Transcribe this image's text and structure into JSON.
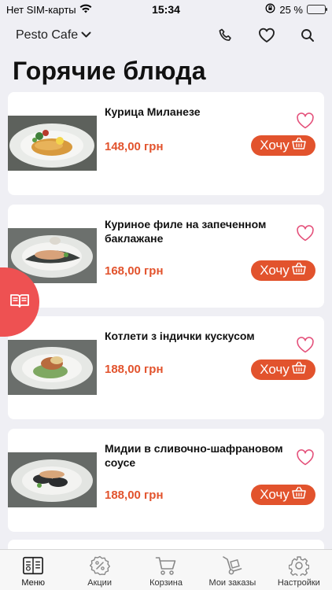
{
  "status_bar": {
    "carrier": "Нет SIM-карты",
    "time": "15:34",
    "battery_text": "25 %",
    "battery_level": 0.25
  },
  "nav": {
    "brand": "Pesto Cafe",
    "icons": [
      "phone-icon",
      "heart-icon",
      "search-icon"
    ]
  },
  "page_title": "Горячие блюда",
  "colors": {
    "accent": "#e2532d",
    "side_tab": "#ee5152",
    "heart": "#e4507a"
  },
  "dishes": [
    {
      "name": "Курица Миланезе",
      "price": "148,00 грн",
      "button": "Хочу"
    },
    {
      "name": "Куриное филе на запеченном баклажане",
      "price": "168,00 грн",
      "button": "Хочу"
    },
    {
      "name": "Котлети з індички кускусом",
      "price": "188,00 грн",
      "button": "Хочу"
    },
    {
      "name": "Мидии в сливочно-шафрановом соусе",
      "price": "188,00 грн",
      "button": "Хочу"
    }
  ],
  "tabs": [
    {
      "label": "Меню",
      "icon": "menu-book-icon",
      "active": true
    },
    {
      "label": "Акции",
      "icon": "discount-gear-icon",
      "active": false
    },
    {
      "label": "Корзина",
      "icon": "cart-icon",
      "active": false
    },
    {
      "label": "Мои заказы",
      "icon": "hand-truck-icon",
      "active": false
    },
    {
      "label": "Настройки",
      "icon": "settings-gear-icon",
      "active": false
    }
  ]
}
